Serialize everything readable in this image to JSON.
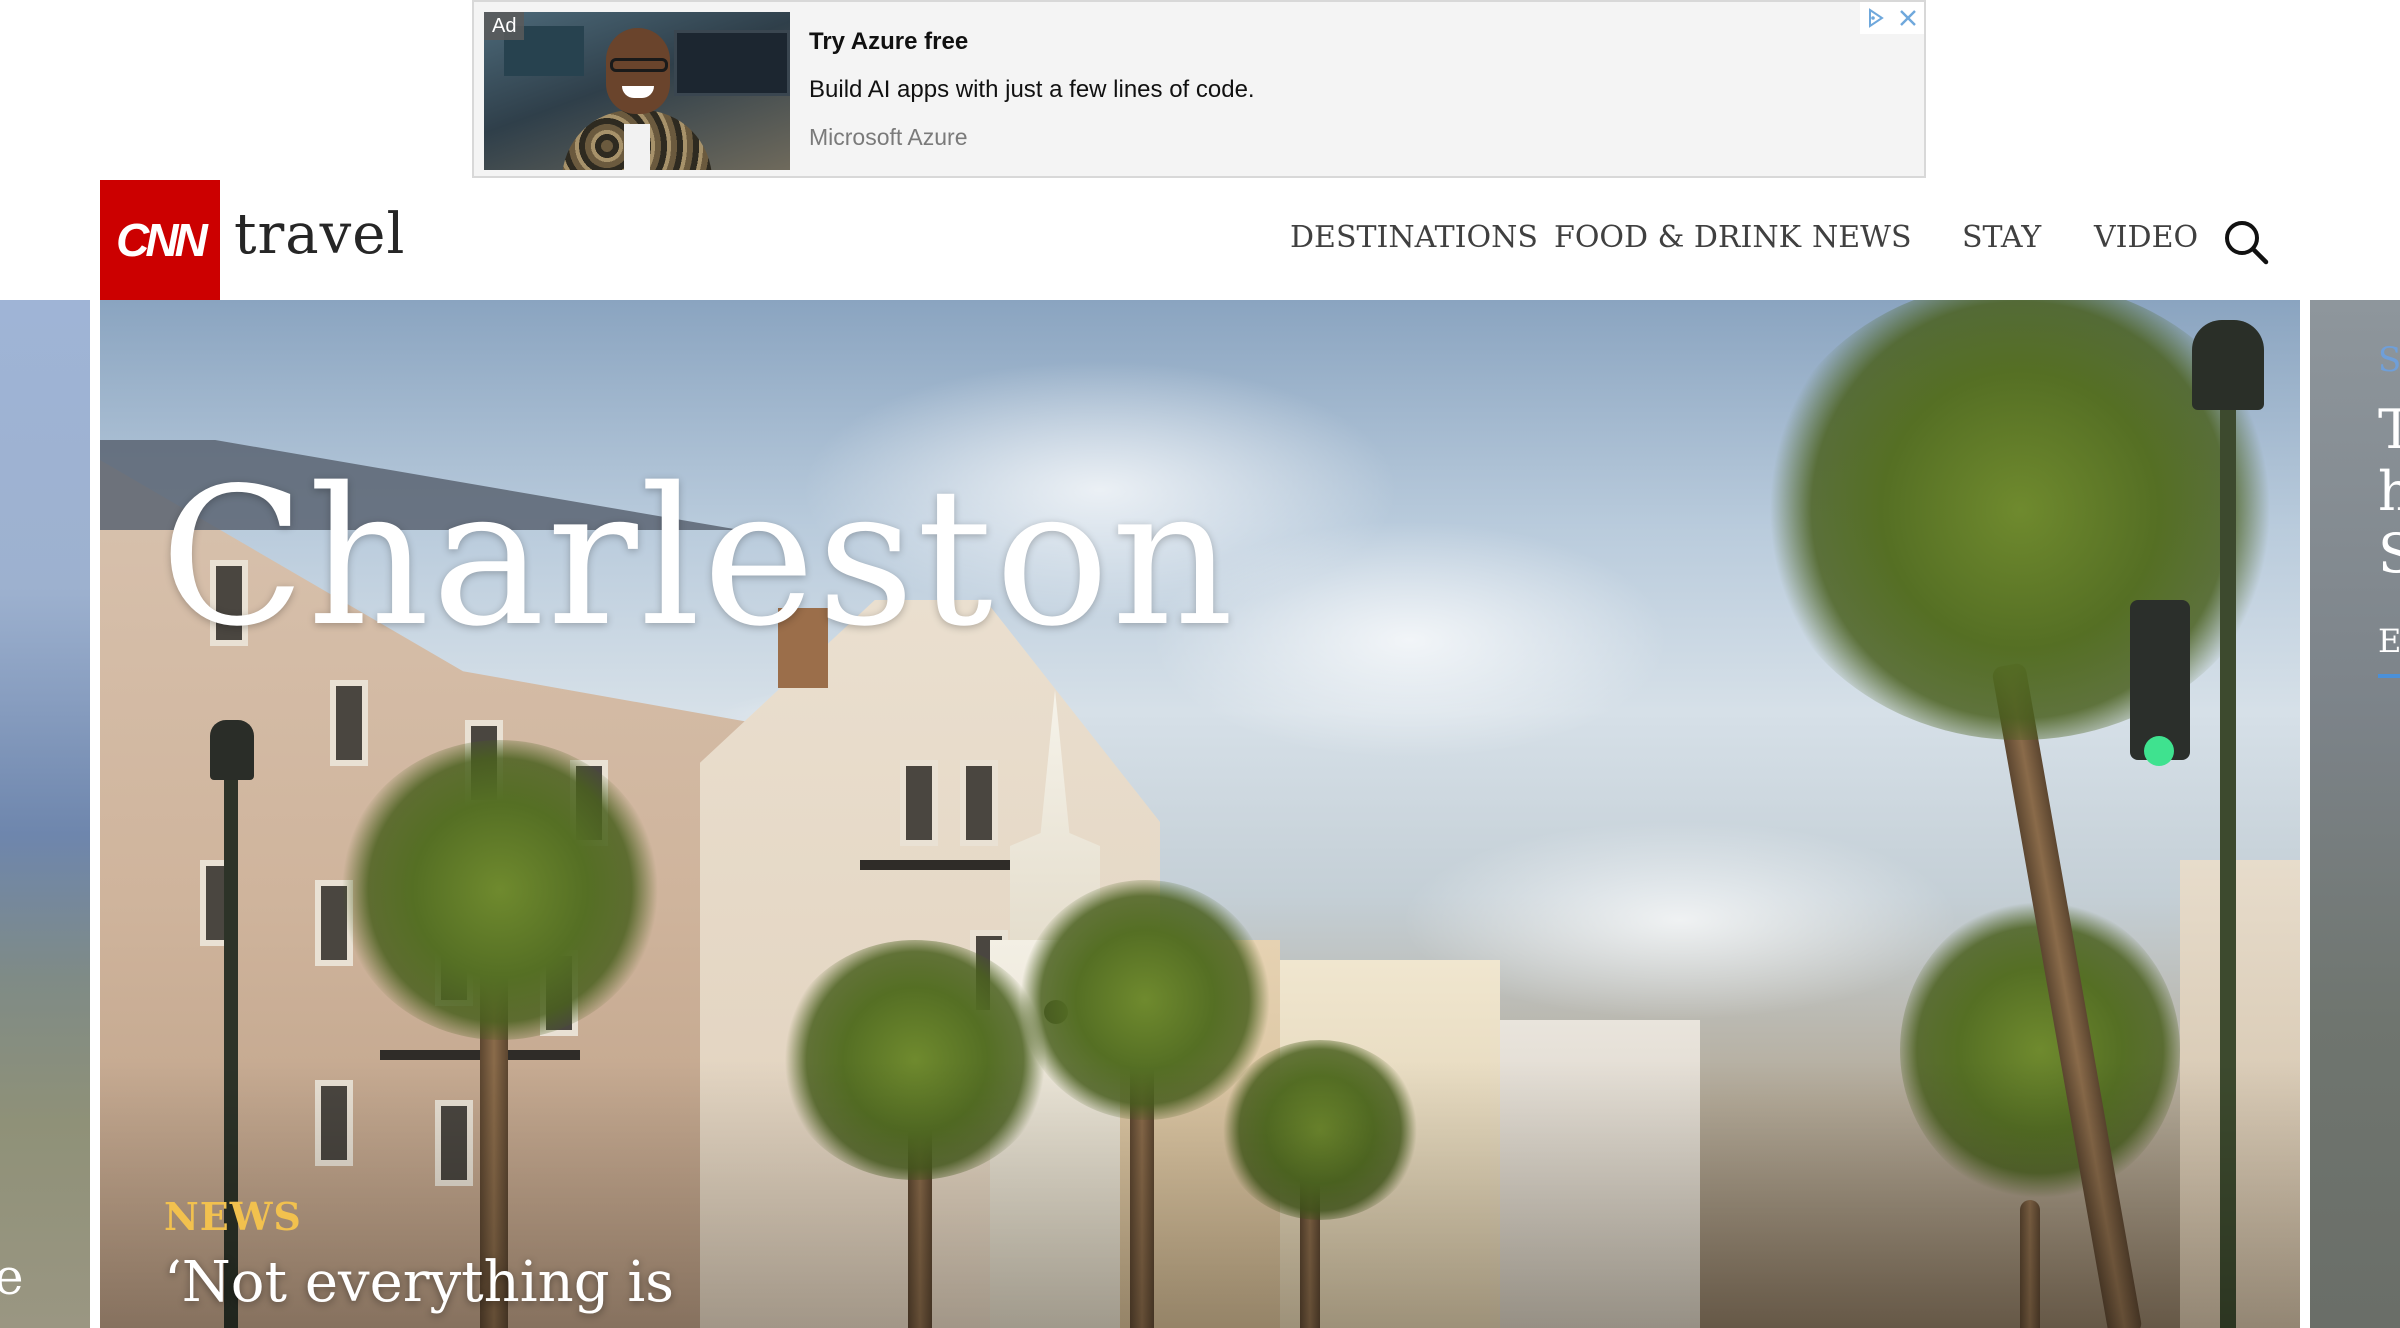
{
  "ad": {
    "badge": "Ad",
    "headline": "Try Azure free",
    "body": "Build AI apps with just a few lines of code.",
    "advertiser": "Microsoft Azure",
    "choices_icon": "adchoices-icon",
    "close_icon": "close-icon",
    "colors": {
      "background": "#f4f4f4",
      "choices": "#6fa8dc"
    }
  },
  "header": {
    "logo": "CNN",
    "section": "travel",
    "nav": [
      {
        "label": "DESTINATIONS"
      },
      {
        "label": "FOOD & DRINK"
      },
      {
        "label": "NEWS"
      },
      {
        "label": "STAY"
      },
      {
        "label": "VIDEO"
      }
    ],
    "search_icon": "search-icon",
    "colors": {
      "brand": "#cc0000",
      "nav_text": "#404040"
    }
  },
  "hero": {
    "title": "Charleston",
    "kicker": "NEWS",
    "headline": "‘Not everything is",
    "colors": {
      "kicker": "#f2c14e"
    }
  },
  "carousel": {
    "prev_peek_text": "e",
    "next_peek_lines": [
      "S",
      "T",
      "h",
      "S",
      "E"
    ]
  }
}
